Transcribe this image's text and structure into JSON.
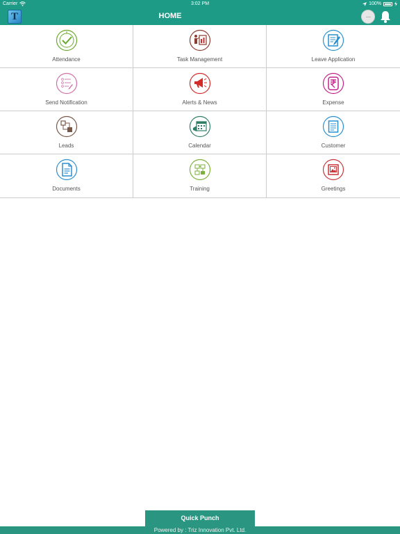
{
  "status": {
    "carrier": "Carrier",
    "time": "3:02 PM",
    "battery": "100%"
  },
  "header": {
    "logo_letter": "T",
    "title": "HOME"
  },
  "menu": [
    {
      "label": "Attendance",
      "icon": "clock-check-icon",
      "color": "#6aa92f"
    },
    {
      "label": "Task Management",
      "icon": "presentation-icon",
      "color": "#8b3d2e"
    },
    {
      "label": "Leave Application",
      "icon": "form-edit-icon",
      "color": "#2a8fd0"
    },
    {
      "label": "Send Notification",
      "icon": "list-icon",
      "color": "#d06fa8"
    },
    {
      "label": "Alerts & News",
      "icon": "megaphone-icon",
      "color": "#d32a2a"
    },
    {
      "label": "Expense",
      "icon": "rupee-icon",
      "color": "#c4238c"
    },
    {
      "label": "Leads",
      "icon": "flow-icon",
      "color": "#7a5647"
    },
    {
      "label": "Calendar",
      "icon": "calendar-icon",
      "color": "#2f7f68"
    },
    {
      "label": "Customer",
      "icon": "document-list-icon",
      "color": "#2a8fd0"
    },
    {
      "label": "Documents",
      "icon": "document-icon",
      "color": "#2a8fd0"
    },
    {
      "label": "Training",
      "icon": "circuit-icon",
      "color": "#7bb13c"
    },
    {
      "label": "Greetings",
      "icon": "picture-card-icon",
      "color": "#c8363a"
    }
  ],
  "quick_punch": "Quick Punch",
  "footer": "Powered by : Triz Innovation Pvt. Ltd.",
  "colors": {
    "primary": "#1d9b87",
    "footer": "#2a9580"
  }
}
